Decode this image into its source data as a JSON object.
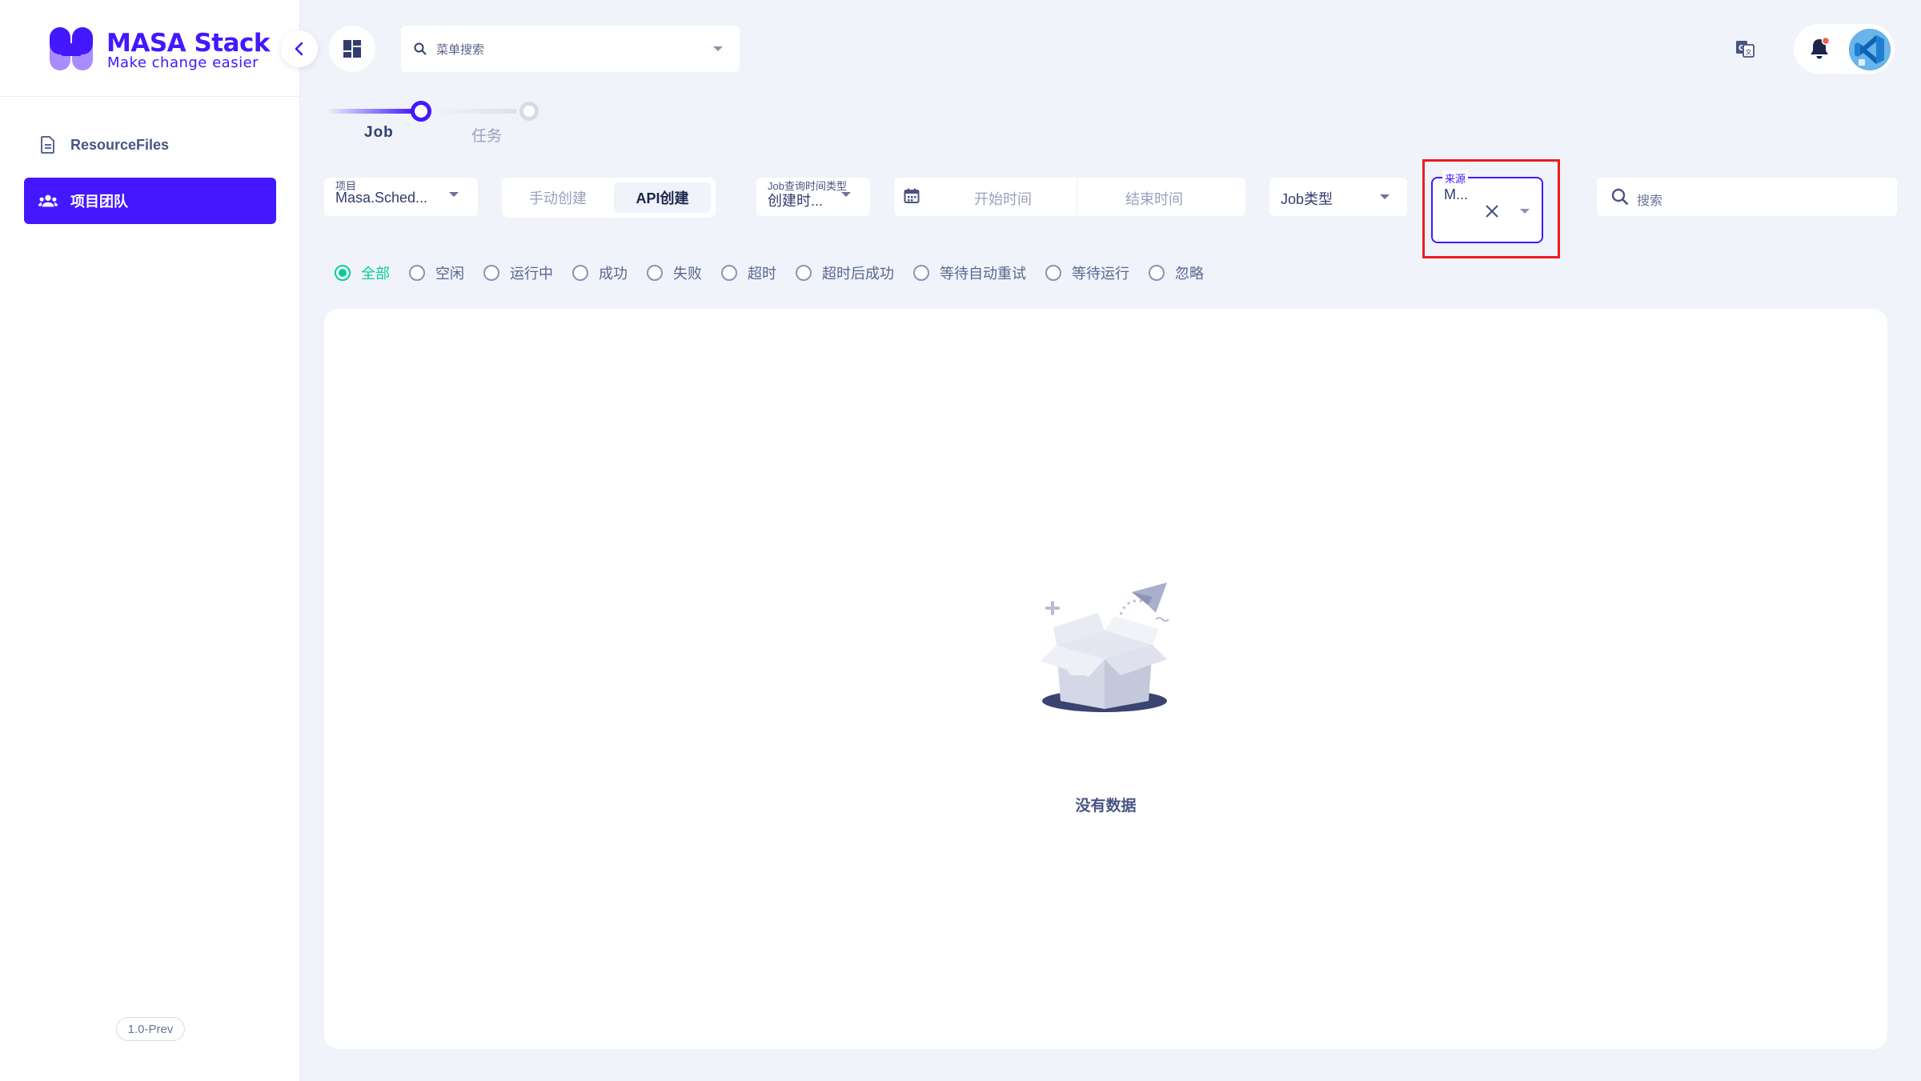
{
  "brand": {
    "title": "MASA Stack",
    "subtitle": "Make change easier",
    "color": "#4318ff"
  },
  "sidebar": {
    "items": [
      {
        "label": "ResourceFiles",
        "icon": "file-icon",
        "active": false
      },
      {
        "label": "项目团队",
        "icon": "team-icon",
        "active": true
      }
    ],
    "version": "1.0-Prev"
  },
  "header": {
    "menu_search_placeholder": "菜单搜索",
    "icons": [
      "dashboard-icon",
      "translate-icon",
      "bell-icon",
      "avatar"
    ]
  },
  "stepper": {
    "steps": [
      "Job",
      "任务"
    ],
    "active_index": 0
  },
  "filters": {
    "project": {
      "label": "项目",
      "value": "Masa.Sched..."
    },
    "create_toggle": {
      "options": [
        "手动创建",
        "API创建"
      ],
      "selected": "API创建"
    },
    "time_type": {
      "label": "Job查询时间类型",
      "value": "创建时..."
    },
    "date_range": {
      "start_placeholder": "开始时间",
      "end_placeholder": "结束时间"
    },
    "job_type": {
      "placeholder": "Job类型"
    },
    "source": {
      "label": "来源",
      "value": "M..."
    },
    "search": {
      "placeholder": "搜索"
    }
  },
  "status_filter": {
    "options": [
      "全部",
      "空闲",
      "运行中",
      "成功",
      "失败",
      "超时",
      "超时后成功",
      "等待自动重试",
      "等待运行",
      "忽略"
    ],
    "selected": "全部",
    "selected_color": "#05cd99"
  },
  "content": {
    "empty_text": "没有数据"
  }
}
